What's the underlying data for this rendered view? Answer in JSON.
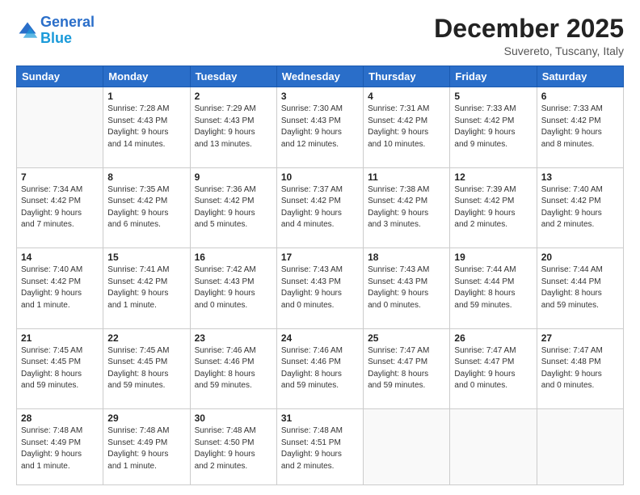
{
  "header": {
    "logo_line1": "General",
    "logo_line2": "Blue",
    "month": "December 2025",
    "location": "Suvereto, Tuscany, Italy"
  },
  "weekdays": [
    "Sunday",
    "Monday",
    "Tuesday",
    "Wednesday",
    "Thursday",
    "Friday",
    "Saturday"
  ],
  "weeks": [
    [
      {
        "day": "",
        "info": ""
      },
      {
        "day": "1",
        "info": "Sunrise: 7:28 AM\nSunset: 4:43 PM\nDaylight: 9 hours\nand 14 minutes."
      },
      {
        "day": "2",
        "info": "Sunrise: 7:29 AM\nSunset: 4:43 PM\nDaylight: 9 hours\nand 13 minutes."
      },
      {
        "day": "3",
        "info": "Sunrise: 7:30 AM\nSunset: 4:43 PM\nDaylight: 9 hours\nand 12 minutes."
      },
      {
        "day": "4",
        "info": "Sunrise: 7:31 AM\nSunset: 4:42 PM\nDaylight: 9 hours\nand 10 minutes."
      },
      {
        "day": "5",
        "info": "Sunrise: 7:33 AM\nSunset: 4:42 PM\nDaylight: 9 hours\nand 9 minutes."
      },
      {
        "day": "6",
        "info": "Sunrise: 7:33 AM\nSunset: 4:42 PM\nDaylight: 9 hours\nand 8 minutes."
      }
    ],
    [
      {
        "day": "7",
        "info": "Sunrise: 7:34 AM\nSunset: 4:42 PM\nDaylight: 9 hours\nand 7 minutes."
      },
      {
        "day": "8",
        "info": "Sunrise: 7:35 AM\nSunset: 4:42 PM\nDaylight: 9 hours\nand 6 minutes."
      },
      {
        "day": "9",
        "info": "Sunrise: 7:36 AM\nSunset: 4:42 PM\nDaylight: 9 hours\nand 5 minutes."
      },
      {
        "day": "10",
        "info": "Sunrise: 7:37 AM\nSunset: 4:42 PM\nDaylight: 9 hours\nand 4 minutes."
      },
      {
        "day": "11",
        "info": "Sunrise: 7:38 AM\nSunset: 4:42 PM\nDaylight: 9 hours\nand 3 minutes."
      },
      {
        "day": "12",
        "info": "Sunrise: 7:39 AM\nSunset: 4:42 PM\nDaylight: 9 hours\nand 2 minutes."
      },
      {
        "day": "13",
        "info": "Sunrise: 7:40 AM\nSunset: 4:42 PM\nDaylight: 9 hours\nand 2 minutes."
      }
    ],
    [
      {
        "day": "14",
        "info": "Sunrise: 7:40 AM\nSunset: 4:42 PM\nDaylight: 9 hours\nand 1 minute."
      },
      {
        "day": "15",
        "info": "Sunrise: 7:41 AM\nSunset: 4:42 PM\nDaylight: 9 hours\nand 1 minute."
      },
      {
        "day": "16",
        "info": "Sunrise: 7:42 AM\nSunset: 4:43 PM\nDaylight: 9 hours\nand 0 minutes."
      },
      {
        "day": "17",
        "info": "Sunrise: 7:43 AM\nSunset: 4:43 PM\nDaylight: 9 hours\nand 0 minutes."
      },
      {
        "day": "18",
        "info": "Sunrise: 7:43 AM\nSunset: 4:43 PM\nDaylight: 9 hours\nand 0 minutes."
      },
      {
        "day": "19",
        "info": "Sunrise: 7:44 AM\nSunset: 4:44 PM\nDaylight: 8 hours\nand 59 minutes."
      },
      {
        "day": "20",
        "info": "Sunrise: 7:44 AM\nSunset: 4:44 PM\nDaylight: 8 hours\nand 59 minutes."
      }
    ],
    [
      {
        "day": "21",
        "info": "Sunrise: 7:45 AM\nSunset: 4:45 PM\nDaylight: 8 hours\nand 59 minutes."
      },
      {
        "day": "22",
        "info": "Sunrise: 7:45 AM\nSunset: 4:45 PM\nDaylight: 8 hours\nand 59 minutes."
      },
      {
        "day": "23",
        "info": "Sunrise: 7:46 AM\nSunset: 4:46 PM\nDaylight: 8 hours\nand 59 minutes."
      },
      {
        "day": "24",
        "info": "Sunrise: 7:46 AM\nSunset: 4:46 PM\nDaylight: 8 hours\nand 59 minutes."
      },
      {
        "day": "25",
        "info": "Sunrise: 7:47 AM\nSunset: 4:47 PM\nDaylight: 8 hours\nand 59 minutes."
      },
      {
        "day": "26",
        "info": "Sunrise: 7:47 AM\nSunset: 4:47 PM\nDaylight: 9 hours\nand 0 minutes."
      },
      {
        "day": "27",
        "info": "Sunrise: 7:47 AM\nSunset: 4:48 PM\nDaylight: 9 hours\nand 0 minutes."
      }
    ],
    [
      {
        "day": "28",
        "info": "Sunrise: 7:48 AM\nSunset: 4:49 PM\nDaylight: 9 hours\nand 1 minute."
      },
      {
        "day": "29",
        "info": "Sunrise: 7:48 AM\nSunset: 4:49 PM\nDaylight: 9 hours\nand 1 minute."
      },
      {
        "day": "30",
        "info": "Sunrise: 7:48 AM\nSunset: 4:50 PM\nDaylight: 9 hours\nand 2 minutes."
      },
      {
        "day": "31",
        "info": "Sunrise: 7:48 AM\nSunset: 4:51 PM\nDaylight: 9 hours\nand 2 minutes."
      },
      {
        "day": "",
        "info": ""
      },
      {
        "day": "",
        "info": ""
      },
      {
        "day": "",
        "info": ""
      }
    ]
  ]
}
